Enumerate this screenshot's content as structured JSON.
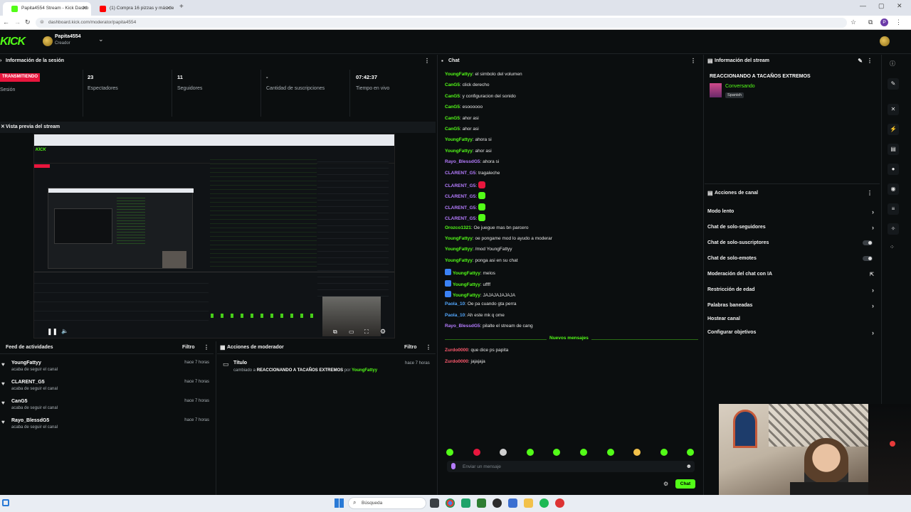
{
  "browser": {
    "tabs": [
      {
        "label": "Papita4554 Stream - Kick Dashb",
        "active": true
      },
      {
        "label": "(1) Compra 16 pizzas y más de",
        "active": false
      }
    ],
    "url": "dashboard.kick.com/moderator/papita4554",
    "new_tab": "+",
    "profile_letter": "P"
  },
  "header": {
    "logo": "KICK",
    "username": "Papita4554",
    "role": "Creador"
  },
  "session": {
    "title": "Información de la sesión",
    "live_badge": "TRANSMITIENDO",
    "session_label": "Sesión",
    "stats": [
      {
        "value": "23",
        "label": "Espectadores"
      },
      {
        "value": "11",
        "label": "Seguidores"
      },
      {
        "value": "-",
        "label": "Cantidad de suscripciones"
      },
      {
        "value": "07:42:37",
        "label": "Tiempo en vivo"
      }
    ]
  },
  "preview": {
    "title": "Vista previa del stream"
  },
  "activity": {
    "title": "Feed de actividades",
    "filter": "Filtro",
    "items": [
      {
        "name": "YoungFattyy",
        "desc": "acaba de seguir el canal",
        "time": "hace 7 horas"
      },
      {
        "name": "CLARENT_G5",
        "desc": "acaba de seguir el canal",
        "time": "hace 7 horas"
      },
      {
        "name": "CanG5",
        "desc": "acaba de seguir el canal",
        "time": "hace 7 horas"
      },
      {
        "name": "Rayo_BlessdG5",
        "desc": "acaba de seguir el canal",
        "time": "hace 7 horas"
      }
    ]
  },
  "moderator": {
    "title": "Acciones de moderador",
    "filter": "Filtro",
    "item": {
      "label": "Título",
      "prefix": "cambiado a",
      "value": "REACCIONANDO A TACAÑOS EXTREMOS",
      "by": "por",
      "user": "YoungFattyy",
      "time": "hace 7 horas"
    }
  },
  "chat": {
    "title": "Chat",
    "messages": [
      {
        "user": "YoungFattyy",
        "text": "el simbolo del volumen",
        "color": "#53fc18"
      },
      {
        "user": "CanG5",
        "text": "click derecho",
        "color": "#53fc18"
      },
      {
        "user": "CanG5",
        "text": "y configuracion del sonido",
        "color": "#53fc18"
      },
      {
        "user": "CanG5",
        "text": "esoooooo",
        "color": "#53fc18"
      },
      {
        "user": "CanG5",
        "text": "ahor asi",
        "color": "#53fc18"
      },
      {
        "user": "CanG5",
        "text": "ahor asi",
        "color": "#53fc18"
      },
      {
        "user": "YoungFattyy",
        "text": "ahora si",
        "color": "#53fc18"
      },
      {
        "user": "YoungFattyy",
        "text": "ahor asi",
        "color": "#53fc18"
      },
      {
        "user": "Rayo_BlessdG5",
        "text": "ahora si",
        "color": "#b57cff"
      },
      {
        "user": "CLARENT_G5",
        "text": "tragaleche",
        "color": "#b57cff"
      },
      {
        "user": "CLARENT_G5",
        "text": "",
        "color": "#b57cff"
      },
      {
        "user": "CLARENT_G5",
        "text": "",
        "color": "#b57cff"
      },
      {
        "user": "CLARENT_G5",
        "text": "",
        "color": "#b57cff"
      },
      {
        "user": "CLARENT_G5",
        "text": "",
        "color": "#b57cff"
      },
      {
        "user": "Orozco1321",
        "text": "Oe juegue mas bn parcero",
        "color": "#53fc18"
      },
      {
        "user": "YoungFattyy",
        "text": "oe pongame mod lo ayudo a moderar",
        "color": "#53fc18"
      },
      {
        "user": "YoungFattyy",
        "text": "/mod YoungFattyy",
        "color": "#53fc18"
      },
      {
        "user": "YoungFattyy",
        "text": "ponga asi en su chat",
        "color": "#53fc18"
      },
      {
        "user": "YoungFattyy",
        "text": "melos",
        "color": "#53fc18"
      },
      {
        "user": "YoungFattyy",
        "text": "uffff",
        "color": "#53fc18"
      },
      {
        "user": "YoungFattyy",
        "text": "JAJAJAJAJAJA",
        "color": "#53fc18"
      },
      {
        "user": "Paola_10",
        "text": "Oe pa cuando gta perra",
        "color": "#53a8ff"
      },
      {
        "user": "Paola_10",
        "text": "Ah este mk q ome",
        "color": "#53a8ff"
      },
      {
        "user": "Rayo_BlessdG5",
        "text": "pilalte el stream de cang",
        "color": "#b57cff"
      }
    ],
    "new_messages": "Nuevos mensajes",
    "new": [
      {
        "user": "Zurdo0000",
        "text": "que dice ps papita",
        "color": "#ff5a6e"
      },
      {
        "user": "Zurdo0000",
        "text": "jajajaja",
        "color": "#ff5a6e"
      }
    ],
    "placeholder": "Enviar un mensaje",
    "send": "Chat"
  },
  "stream_info": {
    "title": "Información del stream",
    "stream_title": "REACCIONANDO A TACAÑOS EXTREMOS",
    "category": "Conversando",
    "language": "Spanish"
  },
  "channel_actions": {
    "title": "Acciones de canal",
    "items": [
      {
        "label": "Modo lento",
        "kind": "chevron"
      },
      {
        "label": "Chat de solo-seguidores",
        "kind": "chevron"
      },
      {
        "label": "Chat de solo-suscriptores",
        "kind": "toggle"
      },
      {
        "label": "Chat de solo-emotes",
        "kind": "toggle"
      },
      {
        "label": "Moderación del chat con IA",
        "kind": "external"
      },
      {
        "label": "Restricción de edad",
        "kind": "chevron"
      },
      {
        "label": "Palabras baneadas",
        "kind": "chevron"
      },
      {
        "label": "Hostear canal",
        "kind": "none"
      },
      {
        "label": "Configurar objetivos",
        "kind": "chevron"
      }
    ]
  },
  "taskbar": {
    "search": "Búsqueda"
  },
  "colors": {
    "accent": "#53fc18",
    "live": "#e8163d",
    "bg": "#0b0e0f",
    "panel": "#0f1214"
  }
}
